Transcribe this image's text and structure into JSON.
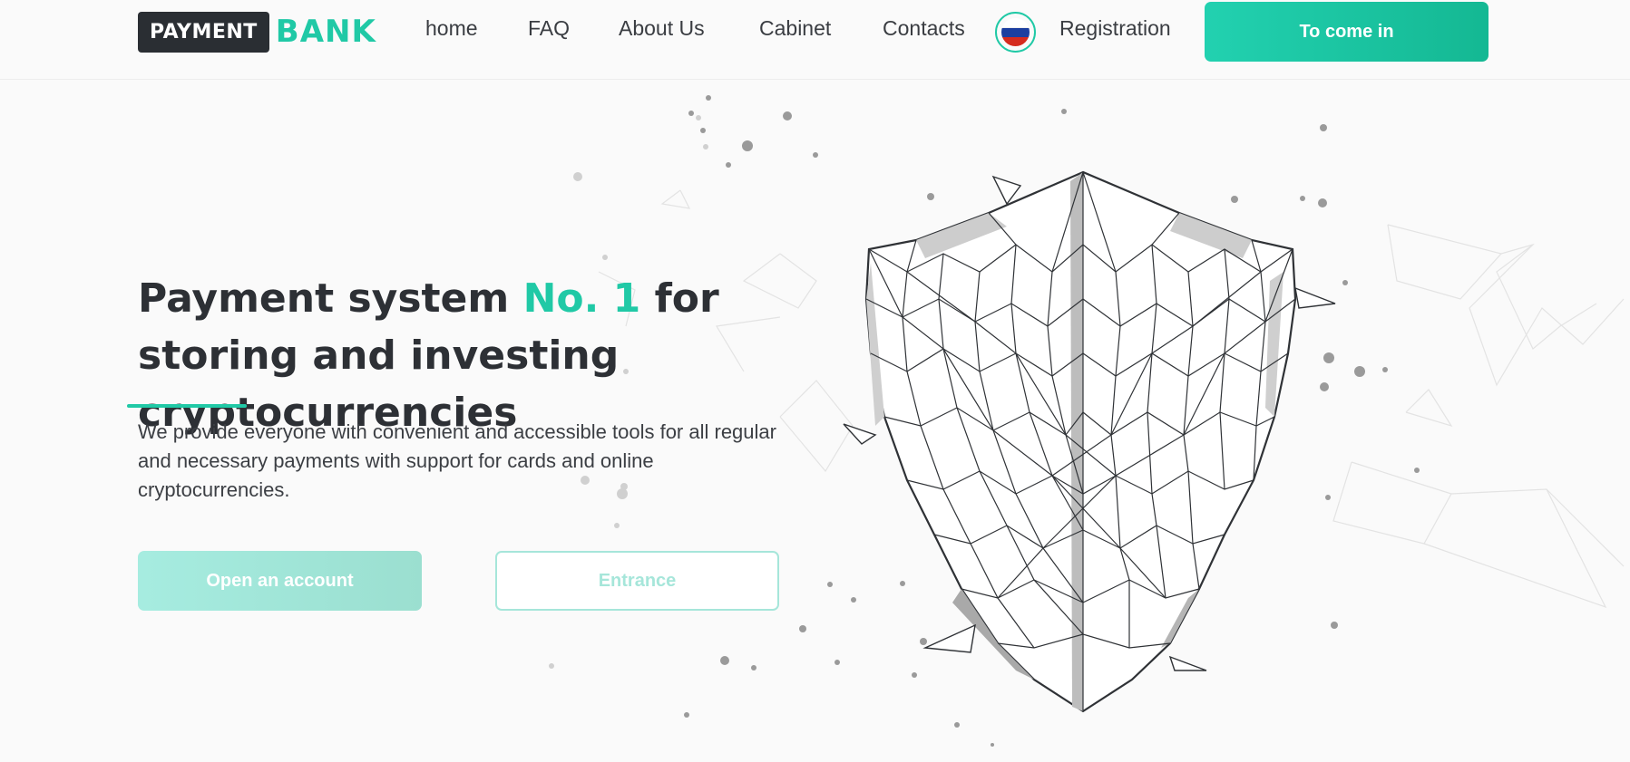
{
  "header": {
    "logo": {
      "box_text": "PAYMENT",
      "word_text": "BANK"
    },
    "nav": [
      {
        "label": "home"
      },
      {
        "label": "FAQ"
      },
      {
        "label": "About Us"
      },
      {
        "label": "Cabinet"
      },
      {
        "label": "Contacts"
      }
    ],
    "language_icon": "russia-flag-icon",
    "registration_label": "Registration",
    "login_label": "To come in"
  },
  "hero": {
    "title_part1": "Payment system ",
    "title_accent": "No. 1",
    "title_part2": " for storing and investing cryptocurrencies",
    "description": "We provide everyone with convenient and accessible tools for all regular and necessary payments with support for cards and online cryptocurrencies.",
    "open_account_label": "Open an account",
    "entrance_label": "Entrance",
    "illustration_icon": "polygon-shield-icon"
  },
  "colors": {
    "accent": "#20c9a6",
    "dark": "#2a2e33",
    "background": "#fafafa"
  }
}
